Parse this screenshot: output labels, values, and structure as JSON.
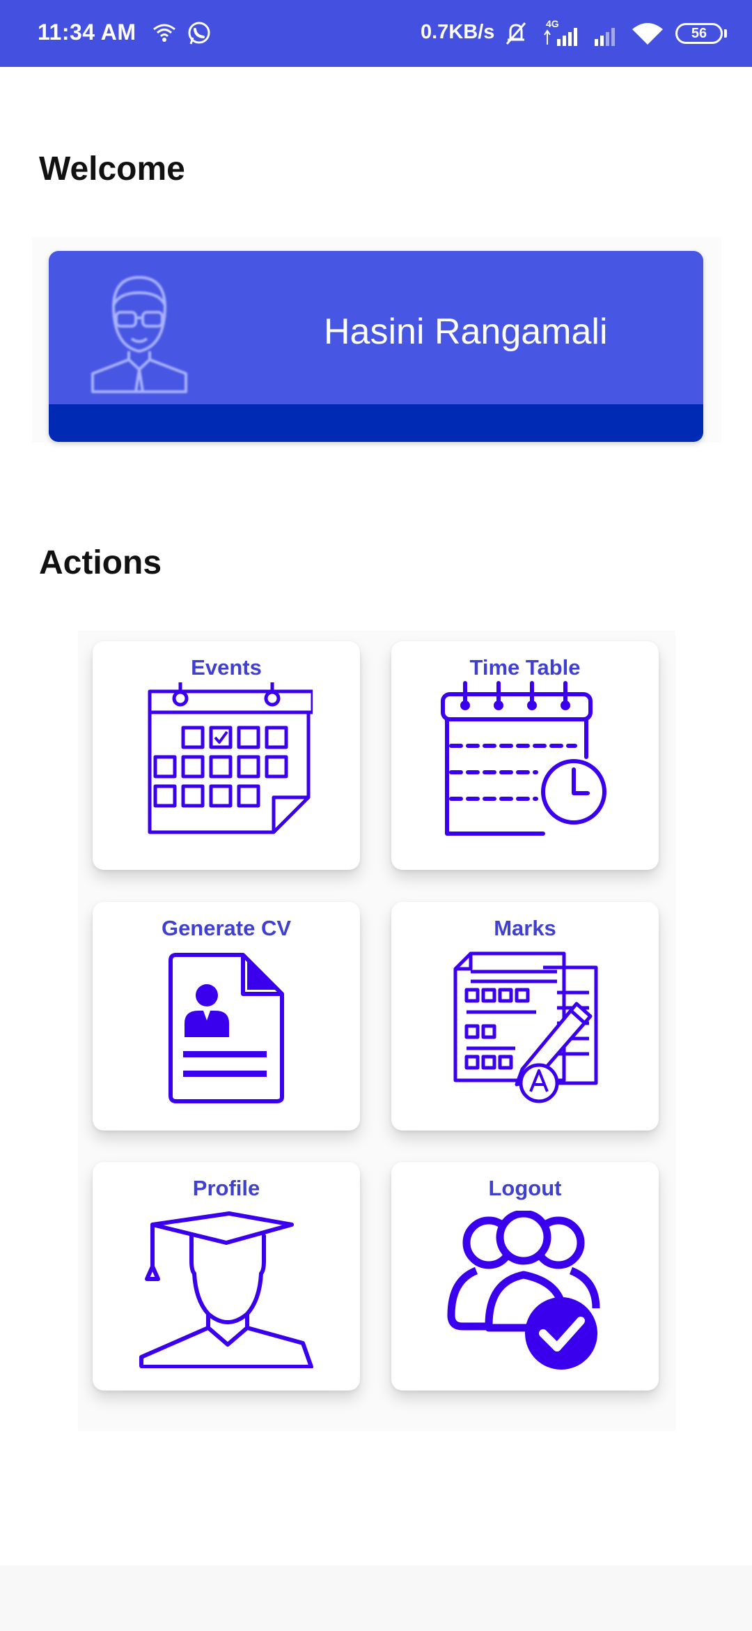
{
  "status_bar": {
    "time": "11:34 AM",
    "network_speed": "0.7KB/s",
    "network_type": "4G",
    "battery": "56",
    "icons": [
      "wifi-calling-icon",
      "whatsapp-icon",
      "mute-bell-icon",
      "signal-icon",
      "signal-icon",
      "wifi-icon",
      "battery-icon"
    ]
  },
  "welcome": {
    "title": "Welcome",
    "user_name": "Hasini Rangamali",
    "avatar_icon": "user-avatar-icon"
  },
  "actions": {
    "title": "Actions",
    "tiles": [
      {
        "label": "Events",
        "icon": "calendar-icon"
      },
      {
        "label": "Time Table",
        "icon": "timetable-clock-icon"
      },
      {
        "label": "Generate CV",
        "icon": "cv-document-icon"
      },
      {
        "label": "Marks",
        "icon": "marks-sheet-icon"
      },
      {
        "label": "Profile",
        "icon": "graduate-icon"
      },
      {
        "label": "Logout",
        "icon": "users-check-icon"
      }
    ]
  },
  "colors": {
    "status_bar": "#4451e0",
    "card": "#4757e3",
    "card_strip": "#002ab3",
    "tile_label": "#3f3fd0",
    "icon": "#3a00ee"
  }
}
